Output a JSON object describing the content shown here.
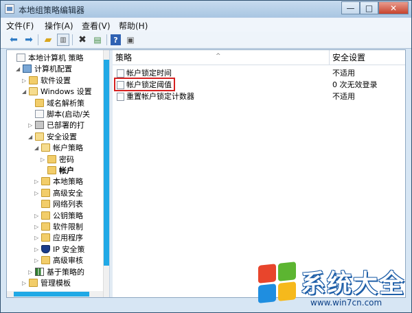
{
  "window": {
    "title": "本地组策略编辑器",
    "buttons": {
      "minimize": "—",
      "maximize": "□",
      "close": "✕"
    }
  },
  "menu": [
    "文件(F)",
    "操作(A)",
    "查看(V)",
    "帮助(H)"
  ],
  "toolbar": [
    "back-icon",
    "forward-icon",
    "up-folder-icon",
    "show-hide-tree-icon",
    "delete-icon",
    "export-list-icon",
    "help-icon",
    "properties-icon"
  ],
  "tree": [
    {
      "label": "本地计算机 策略",
      "icon": "doc",
      "level": 0,
      "arrow": ""
    },
    {
      "label": "计算机配置",
      "icon": "computer",
      "level": 1,
      "arrow": "◢"
    },
    {
      "label": "软件设置",
      "icon": "folder",
      "level": 2,
      "arrow": "▷"
    },
    {
      "label": "Windows 设置",
      "icon": "folder",
      "level": 2,
      "arrow": "◢"
    },
    {
      "label": "域名解析策",
      "icon": "folder",
      "level": 3,
      "arrow": ""
    },
    {
      "label": "脚本(启动/关",
      "icon": "doc",
      "level": 3,
      "arrow": ""
    },
    {
      "label": "已部署的打",
      "icon": "printer",
      "level": 3,
      "arrow": "▷"
    },
    {
      "label": "安全设置",
      "icon": "folder",
      "level": 3,
      "arrow": "◢"
    },
    {
      "label": "帐户策略",
      "icon": "folder",
      "level": 4,
      "arrow": "◢"
    },
    {
      "label": "密码",
      "icon": "folder",
      "level": 5,
      "arrow": "▷"
    },
    {
      "label": "帐户",
      "icon": "folder",
      "level": 5,
      "arrow": "",
      "selected": true
    },
    {
      "label": "本地策略",
      "icon": "folder",
      "level": 4,
      "arrow": "▷"
    },
    {
      "label": "高级安全",
      "icon": "folder",
      "level": 4,
      "arrow": "▷"
    },
    {
      "label": "网络列表",
      "icon": "folder",
      "level": 4,
      "arrow": ""
    },
    {
      "label": "公钥策略",
      "icon": "folder",
      "level": 4,
      "arrow": "▷"
    },
    {
      "label": "软件限制",
      "icon": "folder",
      "level": 4,
      "arrow": "▷"
    },
    {
      "label": "应用程序",
      "icon": "folder",
      "level": 4,
      "arrow": "▷"
    },
    {
      "label": "IP 安全策",
      "icon": "shield",
      "level": 4,
      "arrow": "▷"
    },
    {
      "label": "高级审核",
      "icon": "folder",
      "level": 4,
      "arrow": "▷"
    },
    {
      "label": "基于策略的",
      "icon": "chart",
      "level": 3,
      "arrow": "▷"
    },
    {
      "label": "管理模板",
      "icon": "folder",
      "level": 2,
      "arrow": "▷"
    }
  ],
  "list": {
    "columns": [
      "策略",
      "安全设置"
    ],
    "rows": [
      {
        "name": "帐户锁定时间",
        "value": "不适用"
      },
      {
        "name": "帐户锁定阈值",
        "value": "0 次无效登录",
        "highlighted": true
      },
      {
        "name": "重置帐户锁定计数器",
        "value": "不适用"
      }
    ]
  },
  "watermark": {
    "title": "系统大全",
    "url": "www.win7cn.com",
    "flag_colors": [
      "#e8452c",
      "#5cb531",
      "#1f8ee0",
      "#f6b91c"
    ]
  }
}
